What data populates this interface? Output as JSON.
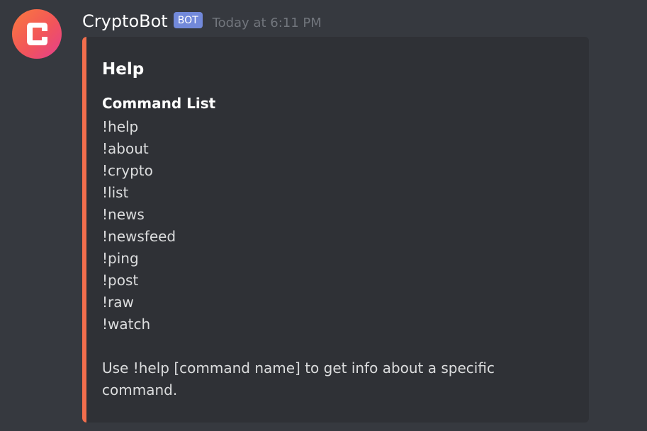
{
  "message": {
    "author": "CryptoBot",
    "bot_tag": "BOT",
    "timestamp": "Today at 6:11 PM",
    "avatar_icon": "cryptobot-c-logo-icon"
  },
  "embed": {
    "accent_color": "#f26e4d",
    "title": "Help",
    "field_name": "Command List",
    "commands": [
      "!help",
      "!about",
      "!crypto",
      "!list",
      "!news",
      "!newsfeed",
      "!ping",
      "!post",
      "!raw",
      "!watch"
    ],
    "footer_text": "Use !help [command name] to get info about a specific command."
  },
  "colors": {
    "background": "#36393f",
    "embed_background": "#2f3136",
    "bot_tag": "#7289da",
    "timestamp": "#72767d"
  }
}
